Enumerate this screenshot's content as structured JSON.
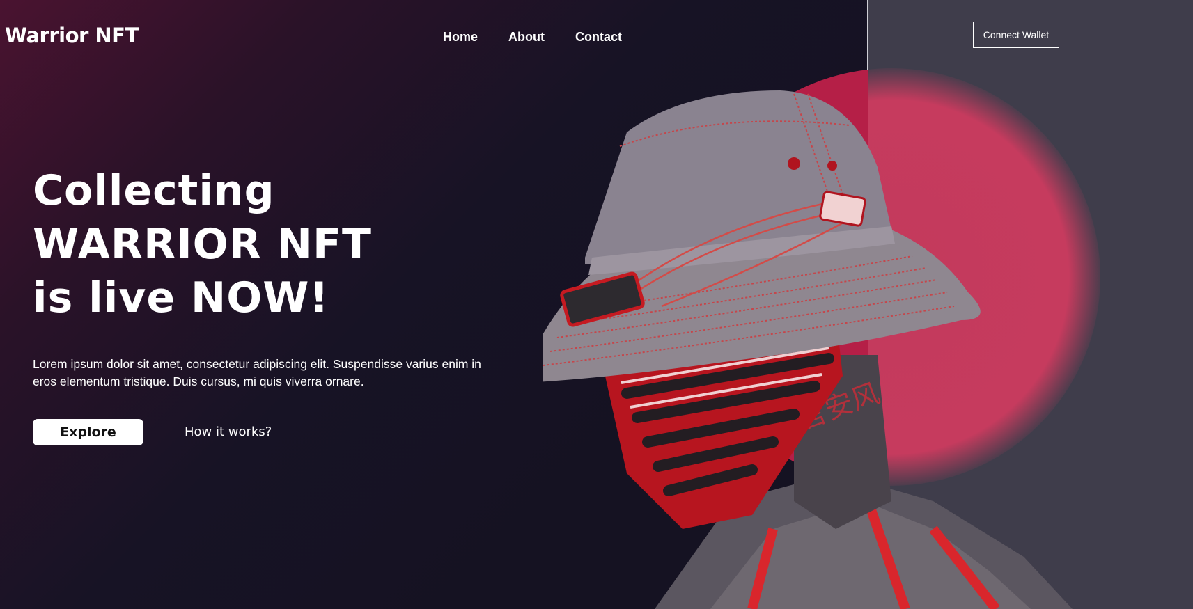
{
  "header": {
    "logo": "Warrior NFT",
    "nav": [
      "Home",
      "About",
      "Contact"
    ],
    "connect_wallet": "Connect Wallet"
  },
  "hero": {
    "title_lines": [
      "Collecting",
      "WARRIOR NFT",
      "is live NOW!"
    ],
    "description": "Lorem ipsum dolor sit amet, consectetur adipiscing elit. Suspendisse varius enim in eros elementum tristique. Duis cursus, mi quis viverra ornare.",
    "explore_label": "Explore",
    "how_label": "How it works?"
  },
  "artwork": {
    "neck_text": "言安风"
  },
  "colors": {
    "accent": "#c33a5c",
    "panel": "#3f3d4b",
    "background": "#151222"
  }
}
